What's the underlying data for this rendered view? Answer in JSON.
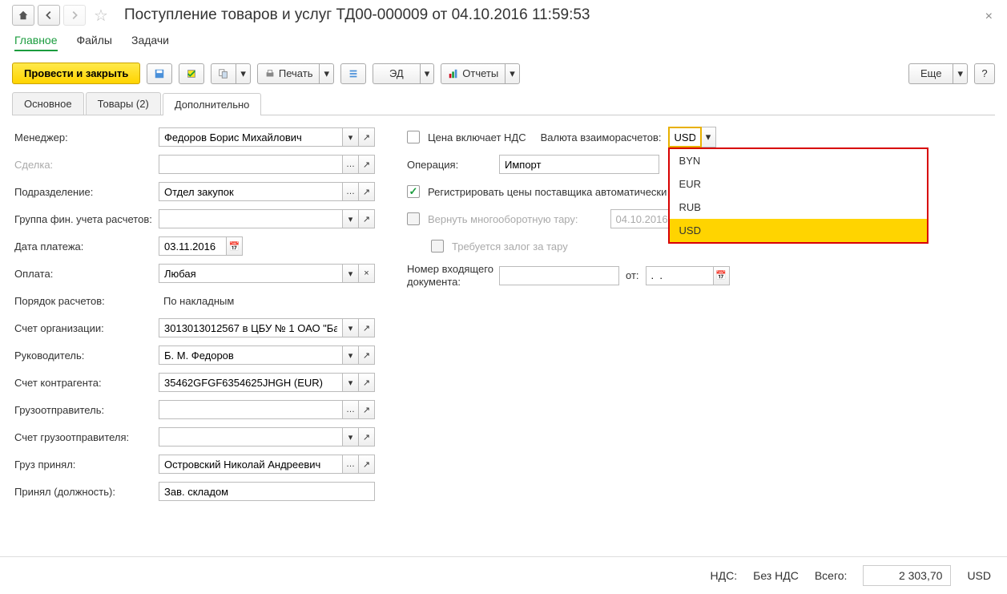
{
  "header": {
    "title": "Поступление товаров и услуг ТД00-000009 от 04.10.2016 11:59:53"
  },
  "menubar": {
    "main": "Главное",
    "files": "Файлы",
    "tasks": "Задачи"
  },
  "actionbar": {
    "post_close": "Провести и закрыть",
    "print": "Печать",
    "ed": "ЭД",
    "reports": "Отчеты",
    "more": "Еще",
    "help": "?"
  },
  "tabs": {
    "t1": "Основное",
    "t2": "Товары (2)",
    "t3": "Дополнительно"
  },
  "left": {
    "manager_lbl": "Менеджер:",
    "manager_val": "Федоров Борис Михайлович",
    "deal_lbl": "Сделка:",
    "dept_lbl": "Подразделение:",
    "dept_val": "Отдел закупок",
    "fingroup_lbl": "Группа фин. учета расчетов:",
    "paydate_lbl": "Дата платежа:",
    "paydate_val": "03.11.2016",
    "payment_lbl": "Оплата:",
    "payment_val": "Любая",
    "calcorder_lbl": "Порядок расчетов:",
    "calcorder_val": "По накладным",
    "orgacc_lbl": "Счет организации:",
    "orgacc_val": "3013013012567 в ЦБУ № 1 ОАО \"Ба",
    "head_lbl": "Руководитель:",
    "head_val": "Б. М. Федоров",
    "contracc_lbl": "Счет контрагента:",
    "contracc_val": "35462GFGF6354625JHGH (EUR)",
    "shipper_lbl": "Грузоотправитель:",
    "shipperacc_lbl": "Счет грузоотправителя:",
    "received_lbl": "Груз принял:",
    "received_val": "Островский Николай Андреевич",
    "receivedpos_lbl": "Принял (должность):",
    "receivedpos_val": "Зав. складом"
  },
  "right": {
    "price_vat_lbl": "Цена включает НДС",
    "currency_lbl": "Валюта взаиморасчетов:",
    "currency_val": "USD",
    "currency_opts": {
      "o1": "BYN",
      "o2": "EUR",
      "o3": "RUB",
      "o4": "USD"
    },
    "operation_lbl": "Операция:",
    "operation_val": "Импорт",
    "reg_prices_lbl": "Регистрировать цены поставщика автоматически",
    "return_tare_lbl": "Вернуть многооборотную тару:",
    "return_tare_val": "04.10.2016",
    "deposit_lbl": "Требуется залог за тару",
    "incoming_lbl": "Номер входящего документа:",
    "from_lbl": "от:",
    "from_val": ".  ."
  },
  "footer": {
    "vat_lbl": "НДС:",
    "vat_val": "Без НДС",
    "total_lbl": "Всего:",
    "total_val": "2 303,70",
    "cur": "USD"
  }
}
